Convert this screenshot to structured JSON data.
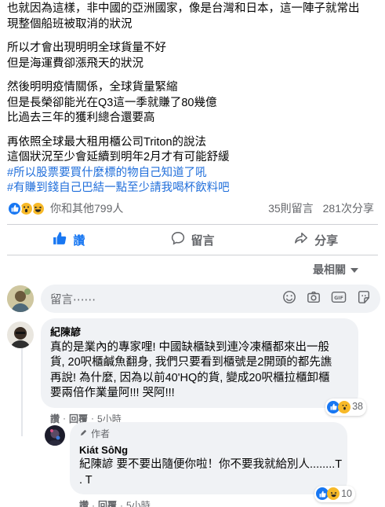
{
  "post": {
    "paragraphs": [
      [
        "也就因為這樣，非中國的亞洲國家，像是台灣和日本，這一陣子就常出",
        "現整個船班被取消的狀況"
      ],
      [
        "所以才會出現明明全球貨量不好",
        "但是海運費卻漲飛天的狀況"
      ],
      [
        "然後明明疫情關係，全球貨量緊縮",
        "但是長榮卻能光在Q3這一季就賺了80幾億",
        "比過去三年的獲利總合還要高"
      ],
      [
        "再依照全球最大租用櫃公司Triton的說法",
        "這個狀況至少會延續到明年2月才有可能舒緩"
      ]
    ],
    "hashtags": [
      "#所以股票要買什麼標的物自己知道了吼",
      "#有賺到錢自己巴結一點至少請我喝杯飲料吧"
    ]
  },
  "reactions": {
    "names": "你和其他799人",
    "comments": "35則留言",
    "shares": "281次分享"
  },
  "actions": {
    "like": "讚",
    "comment": "留言",
    "share": "分享"
  },
  "sort": {
    "label": "最相關"
  },
  "composer": {
    "placeholder": "留言⋯⋯"
  },
  "comments": [
    {
      "author": "紀陳諺",
      "lines": [
        "真的是業內的專家哩! 中國缺櫃缺到連冷凍櫃都來出一般",
        "貨, 20呎櫃鹹魚翻身, 我們只要看到櫃號是2開頭的都先譙",
        "再說! 為什麼, 因為以前40'HQ的貨, 變成20呎櫃拉櫃卸櫃",
        "要兩倍作業量阿!!! 哭阿!!!"
      ],
      "meta": {
        "like": "讚",
        "reply": "回覆",
        "time": "5小時"
      },
      "react_count": "38"
    },
    {
      "badge": "作者",
      "author": "Kiát SôNg",
      "lines": [
        "紀陳諺 要不要出隨便你啦！你不要我就給別人........T",
        ". T"
      ],
      "meta": {
        "like": "讚",
        "reply": "回覆",
        "time": "5小時"
      },
      "react_count": "10"
    }
  ],
  "colors": {
    "accent": "#1877f2",
    "hashtag": "#216fdb",
    "bubble": "#f0f2f5",
    "muted": "#65676b"
  }
}
